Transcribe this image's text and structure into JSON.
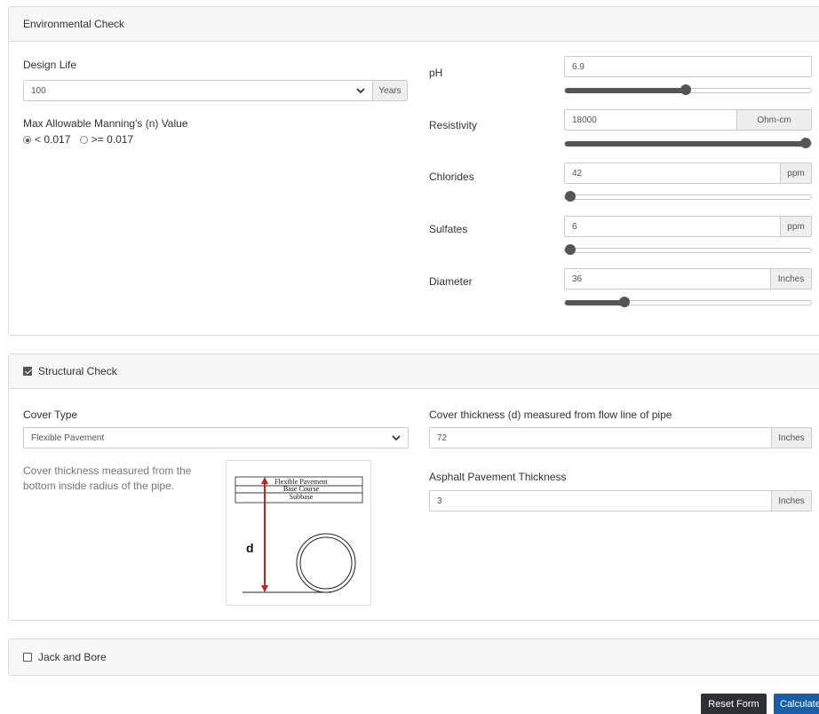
{
  "environmental": {
    "header": "Environmental Check",
    "design_life": {
      "label": "Design Life",
      "value": "100",
      "unit": "Years"
    },
    "manning": {
      "label": "Max Allowable Manning's (n) Value",
      "option1": "< 0.017",
      "option2": ">= 0.017",
      "selected": 1
    },
    "ph": {
      "label": "pH",
      "value": "6.9",
      "slider_fraction": 0.49
    },
    "resistivity": {
      "label": "Resistivity",
      "value": "18000",
      "unit": "Ohm-cm",
      "slider_fraction": 1.0
    },
    "chlorides": {
      "label": "Chlorides",
      "value": "42",
      "unit": "ppm",
      "slider_fraction": 0.0
    },
    "sulfates": {
      "label": "Sulfates",
      "value": "6",
      "unit": "ppm",
      "slider_fraction": 0.0
    },
    "diameter": {
      "label": "Diameter",
      "value": "36",
      "unit": "Inches",
      "slider_fraction": 0.23
    }
  },
  "structural": {
    "header": "Structural Check",
    "checked": true,
    "cover_type": {
      "label": "Cover Type",
      "value": "Flexible Pavement"
    },
    "help_text": "Cover thickness measured from the bottom inside radius of the pipe.",
    "diagram": {
      "layer1": "Flexible Pavement",
      "layer2": "Base Course",
      "layer3": "Subbase",
      "d_label": "d"
    },
    "cover_thickness": {
      "label": "Cover thickness (d) measured from flow line of pipe",
      "value": "72",
      "unit": "Inches"
    },
    "asphalt": {
      "label": "Asphalt Pavement Thickness",
      "value": "3",
      "unit": "Inches"
    }
  },
  "jack_bore": {
    "header": "Jack and Bore",
    "checked": false
  },
  "buttons": {
    "reset": "Reset Form",
    "calculate": "Calculate"
  },
  "colors": {
    "dark_button": "#2d3136",
    "primary_button": "#1a5ea8",
    "diagram_arrow": "#cc1f1f"
  }
}
